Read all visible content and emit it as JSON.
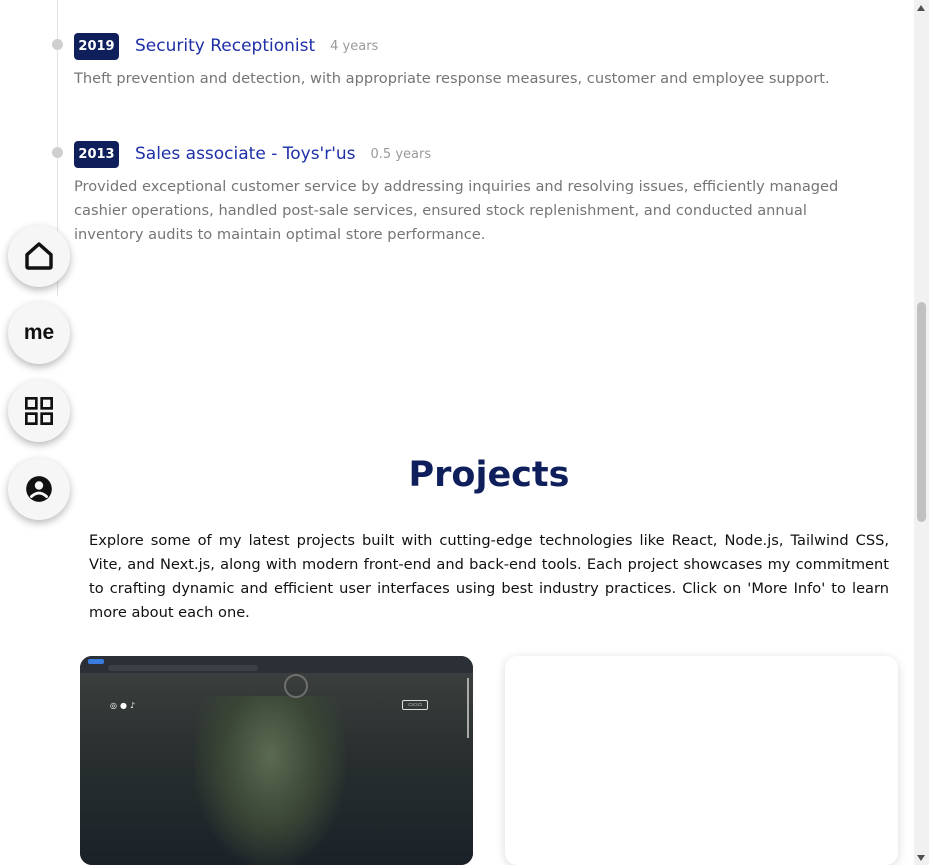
{
  "experience": [
    {
      "year": "2019",
      "title": "Security Receptionist",
      "duration": "4 years",
      "description": "Theft prevention and detection, with appropriate response measures, customer and employee support."
    },
    {
      "year": "2013",
      "title": "Sales associate - Toys'r'us",
      "duration": "0.5 years",
      "description": "Provided exceptional customer service by addressing inquiries and resolving issues, efficiently managed cashier operations, handled post-sale services, ensured stock replenishment, and conducted annual inventory audits to maintain optimal store performance."
    }
  ],
  "nav": {
    "items": [
      {
        "name": "home",
        "icon": "home-icon"
      },
      {
        "name": "about",
        "label": "me"
      },
      {
        "name": "projects",
        "icon": "grid-icon"
      },
      {
        "name": "contact",
        "icon": "account-icon"
      }
    ]
  },
  "projects": {
    "title": "Projects",
    "intro": "Explore some of my latest projects built with cutting-edge technologies like React, Node.js, Tailwind CSS, Vite, and Next.js, along with modern front-end and back-end tools. Each project showcases my commitment to crafting dynamic and efficient user interfaces using best industry practices. Click on 'More Info' to learn more about each one.",
    "cards": [
      {
        "type": "screenshot-preview",
        "social_icons": [
          "instagram-icon",
          "facebook-icon",
          "tiktok-icon"
        ]
      },
      {
        "type": "blank"
      }
    ]
  },
  "colors": {
    "navy": "#0f1f5c",
    "link_blue": "#1e2fa8",
    "muted": "#757575"
  }
}
